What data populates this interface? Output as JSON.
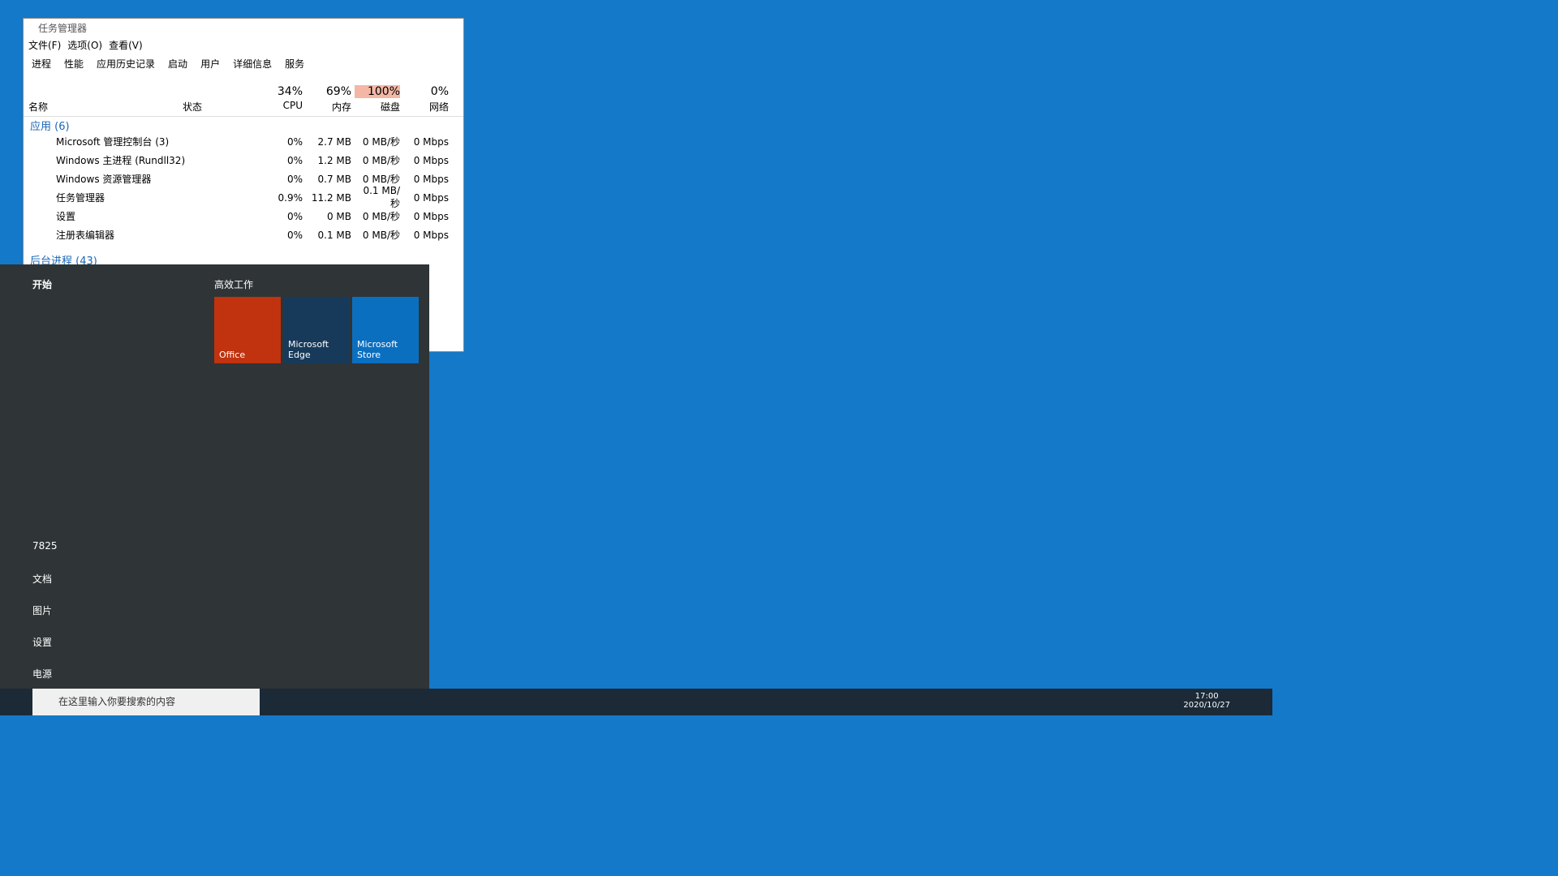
{
  "tm": {
    "title": "任务管理器",
    "menu": [
      "文件(F)",
      "选项(O)",
      "查看(V)"
    ],
    "tabs": [
      "进程",
      "性能",
      "应用历史记录",
      "启动",
      "用户",
      "详细信息",
      "服务"
    ],
    "cols": {
      "name": "名称",
      "status": "状态",
      "cpu": "34%",
      "cpu_l": "CPU",
      "mem": "69%",
      "mem_l": "内存",
      "disk": "100%",
      "disk_l": "磁盘",
      "net": "0%",
      "net_l": "网络"
    },
    "apps": "应用 (6)",
    "bg": "后台进程 (43)",
    "rows": [
      [
        "Microsoft 管理控制台 (3)",
        "0%",
        "2.7 MB",
        "0 MB/秒",
        "0 Mbps"
      ],
      [
        "Windows 主进程 (Rundll32)",
        "0%",
        "1.2 MB",
        "0 MB/秒",
        "0 Mbps"
      ],
      [
        "Windows 资源管理器",
        "0%",
        "0.7 MB",
        "0 MB/秒",
        "0 Mbps"
      ],
      [
        "任务管理器",
        "0.9%",
        "11.2 MB",
        "0.1 MB/秒",
        "0 Mbps"
      ],
      [
        "设置",
        "0%",
        "0 MB",
        "0 MB/秒",
        "0 Mbps"
      ],
      [
        "注册表编辑器",
        "0%",
        "0.1 MB",
        "0 MB/秒",
        "0 Mbps"
      ]
    ]
  },
  "start": {
    "title": "开始",
    "group": "高效工作",
    "tiles": [
      "Office",
      "Microsoft Edge",
      "Microsoft Store"
    ],
    "user": "7825",
    "items": [
      "文档",
      "图片",
      "设置",
      "电源"
    ]
  },
  "task": {
    "search": "在这里输入你要搜索的内容",
    "time": "17:00",
    "date": "2020/10/27"
  }
}
